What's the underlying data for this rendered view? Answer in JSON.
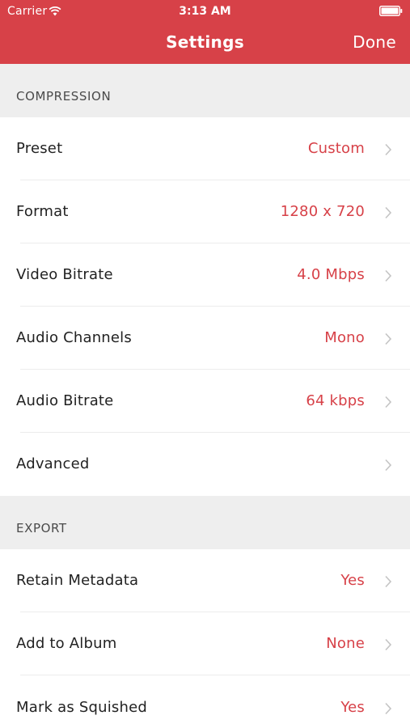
{
  "status_bar": {
    "carrier": "Carrier",
    "time": "3:13 AM",
    "wifi_icon": "wifi-icon",
    "battery_icon": "battery-icon"
  },
  "nav": {
    "title": "Settings",
    "done_label": "Done"
  },
  "colors": {
    "accent": "#d74148",
    "section_background": "#eeeeee",
    "label_text": "#222222",
    "header_text": "#4a4a4a"
  },
  "sections": [
    {
      "header": "COMPRESSION",
      "rows": [
        {
          "label": "Preset",
          "value": "Custom"
        },
        {
          "label": "Format",
          "value": "1280 x 720"
        },
        {
          "label": "Video Bitrate",
          "value": "4.0 Mbps"
        },
        {
          "label": "Audio Channels",
          "value": "Mono"
        },
        {
          "label": "Audio Bitrate",
          "value": "64 kbps"
        },
        {
          "label": "Advanced",
          "value": ""
        }
      ]
    },
    {
      "header": "EXPORT",
      "rows": [
        {
          "label": "Retain Metadata",
          "value": "Yes"
        },
        {
          "label": "Add to Album",
          "value": "None"
        },
        {
          "label": "Mark as Squished",
          "value": "Yes"
        }
      ]
    }
  ],
  "row_icon": "chevron-right-icon"
}
